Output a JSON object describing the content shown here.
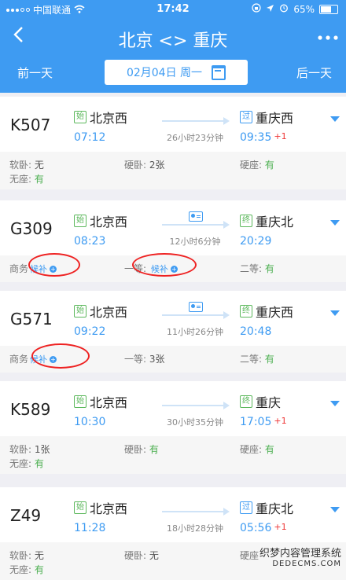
{
  "status": {
    "carrier": "中国联通",
    "time": "17:42",
    "battery": "65%"
  },
  "nav": {
    "title": "北京 <> 重庆",
    "back_icon": "chevron-left-icon",
    "more_icon": "more-icon"
  },
  "datebar": {
    "prev": "前一天",
    "date": "02月04日 周一",
    "next": "后一天"
  },
  "trains": [
    {
      "no": "K507",
      "from_tag": "始",
      "from": "北京西",
      "dep": "07:12",
      "duration": "26小时23分钟",
      "to_tag": "过",
      "to": "重庆西",
      "arr": "09:35",
      "plus": "+1",
      "seats": [
        {
          "label": "软卧: ",
          "value": "无"
        },
        {
          "label": "硬卧: ",
          "value": "2张"
        },
        {
          "label": "硬座: ",
          "value": "有"
        },
        {
          "label": "无座: ",
          "value": "有"
        }
      ]
    },
    {
      "no": "G309",
      "from_tag": "始",
      "from": "北京西",
      "dep": "08:23",
      "duration": "12小时6分钟",
      "to_tag": "终",
      "to": "重庆北",
      "arr": "20:29",
      "plus": "",
      "seats": [
        {
          "label": "商务",
          "value": "候补"
        },
        {
          "label": "一等: ",
          "value": "候补"
        },
        {
          "label": "二等: ",
          "value": "有"
        }
      ]
    },
    {
      "no": "G571",
      "from_tag": "始",
      "from": "北京西",
      "dep": "09:22",
      "duration": "11小时26分钟",
      "to_tag": "终",
      "to": "重庆西",
      "arr": "20:48",
      "plus": "",
      "seats": [
        {
          "label": "商务",
          "value": "候补"
        },
        {
          "label": "一等: ",
          "value": "3张"
        },
        {
          "label": "二等: ",
          "value": "有"
        }
      ]
    },
    {
      "no": "K589",
      "from_tag": "始",
      "from": "北京西",
      "dep": "10:30",
      "duration": "30小时35分钟",
      "to_tag": "终",
      "to": "重庆",
      "arr": "17:05",
      "plus": "+1",
      "seats": [
        {
          "label": "软卧: ",
          "value": "1张"
        },
        {
          "label": "硬卧: ",
          "value": "有"
        },
        {
          "label": "硬座: ",
          "value": "有"
        },
        {
          "label": "无座: ",
          "value": "有"
        }
      ]
    },
    {
      "no": "Z49",
      "from_tag": "始",
      "from": "北京西",
      "dep": "11:28",
      "duration": "18小时28分钟",
      "to_tag": "过",
      "to": "重庆北",
      "arr": "05:56",
      "plus": "+1",
      "seats": [
        {
          "label": "软卧: ",
          "value": "无"
        },
        {
          "label": "硬卧: ",
          "value": "无"
        },
        {
          "label": "硬座",
          "value": ""
        },
        {
          "label": "无座: ",
          "value": "有"
        }
      ]
    }
  ],
  "watermark": {
    "line1": "织梦内容管理系统",
    "line2": "DEDECMS.COM"
  }
}
